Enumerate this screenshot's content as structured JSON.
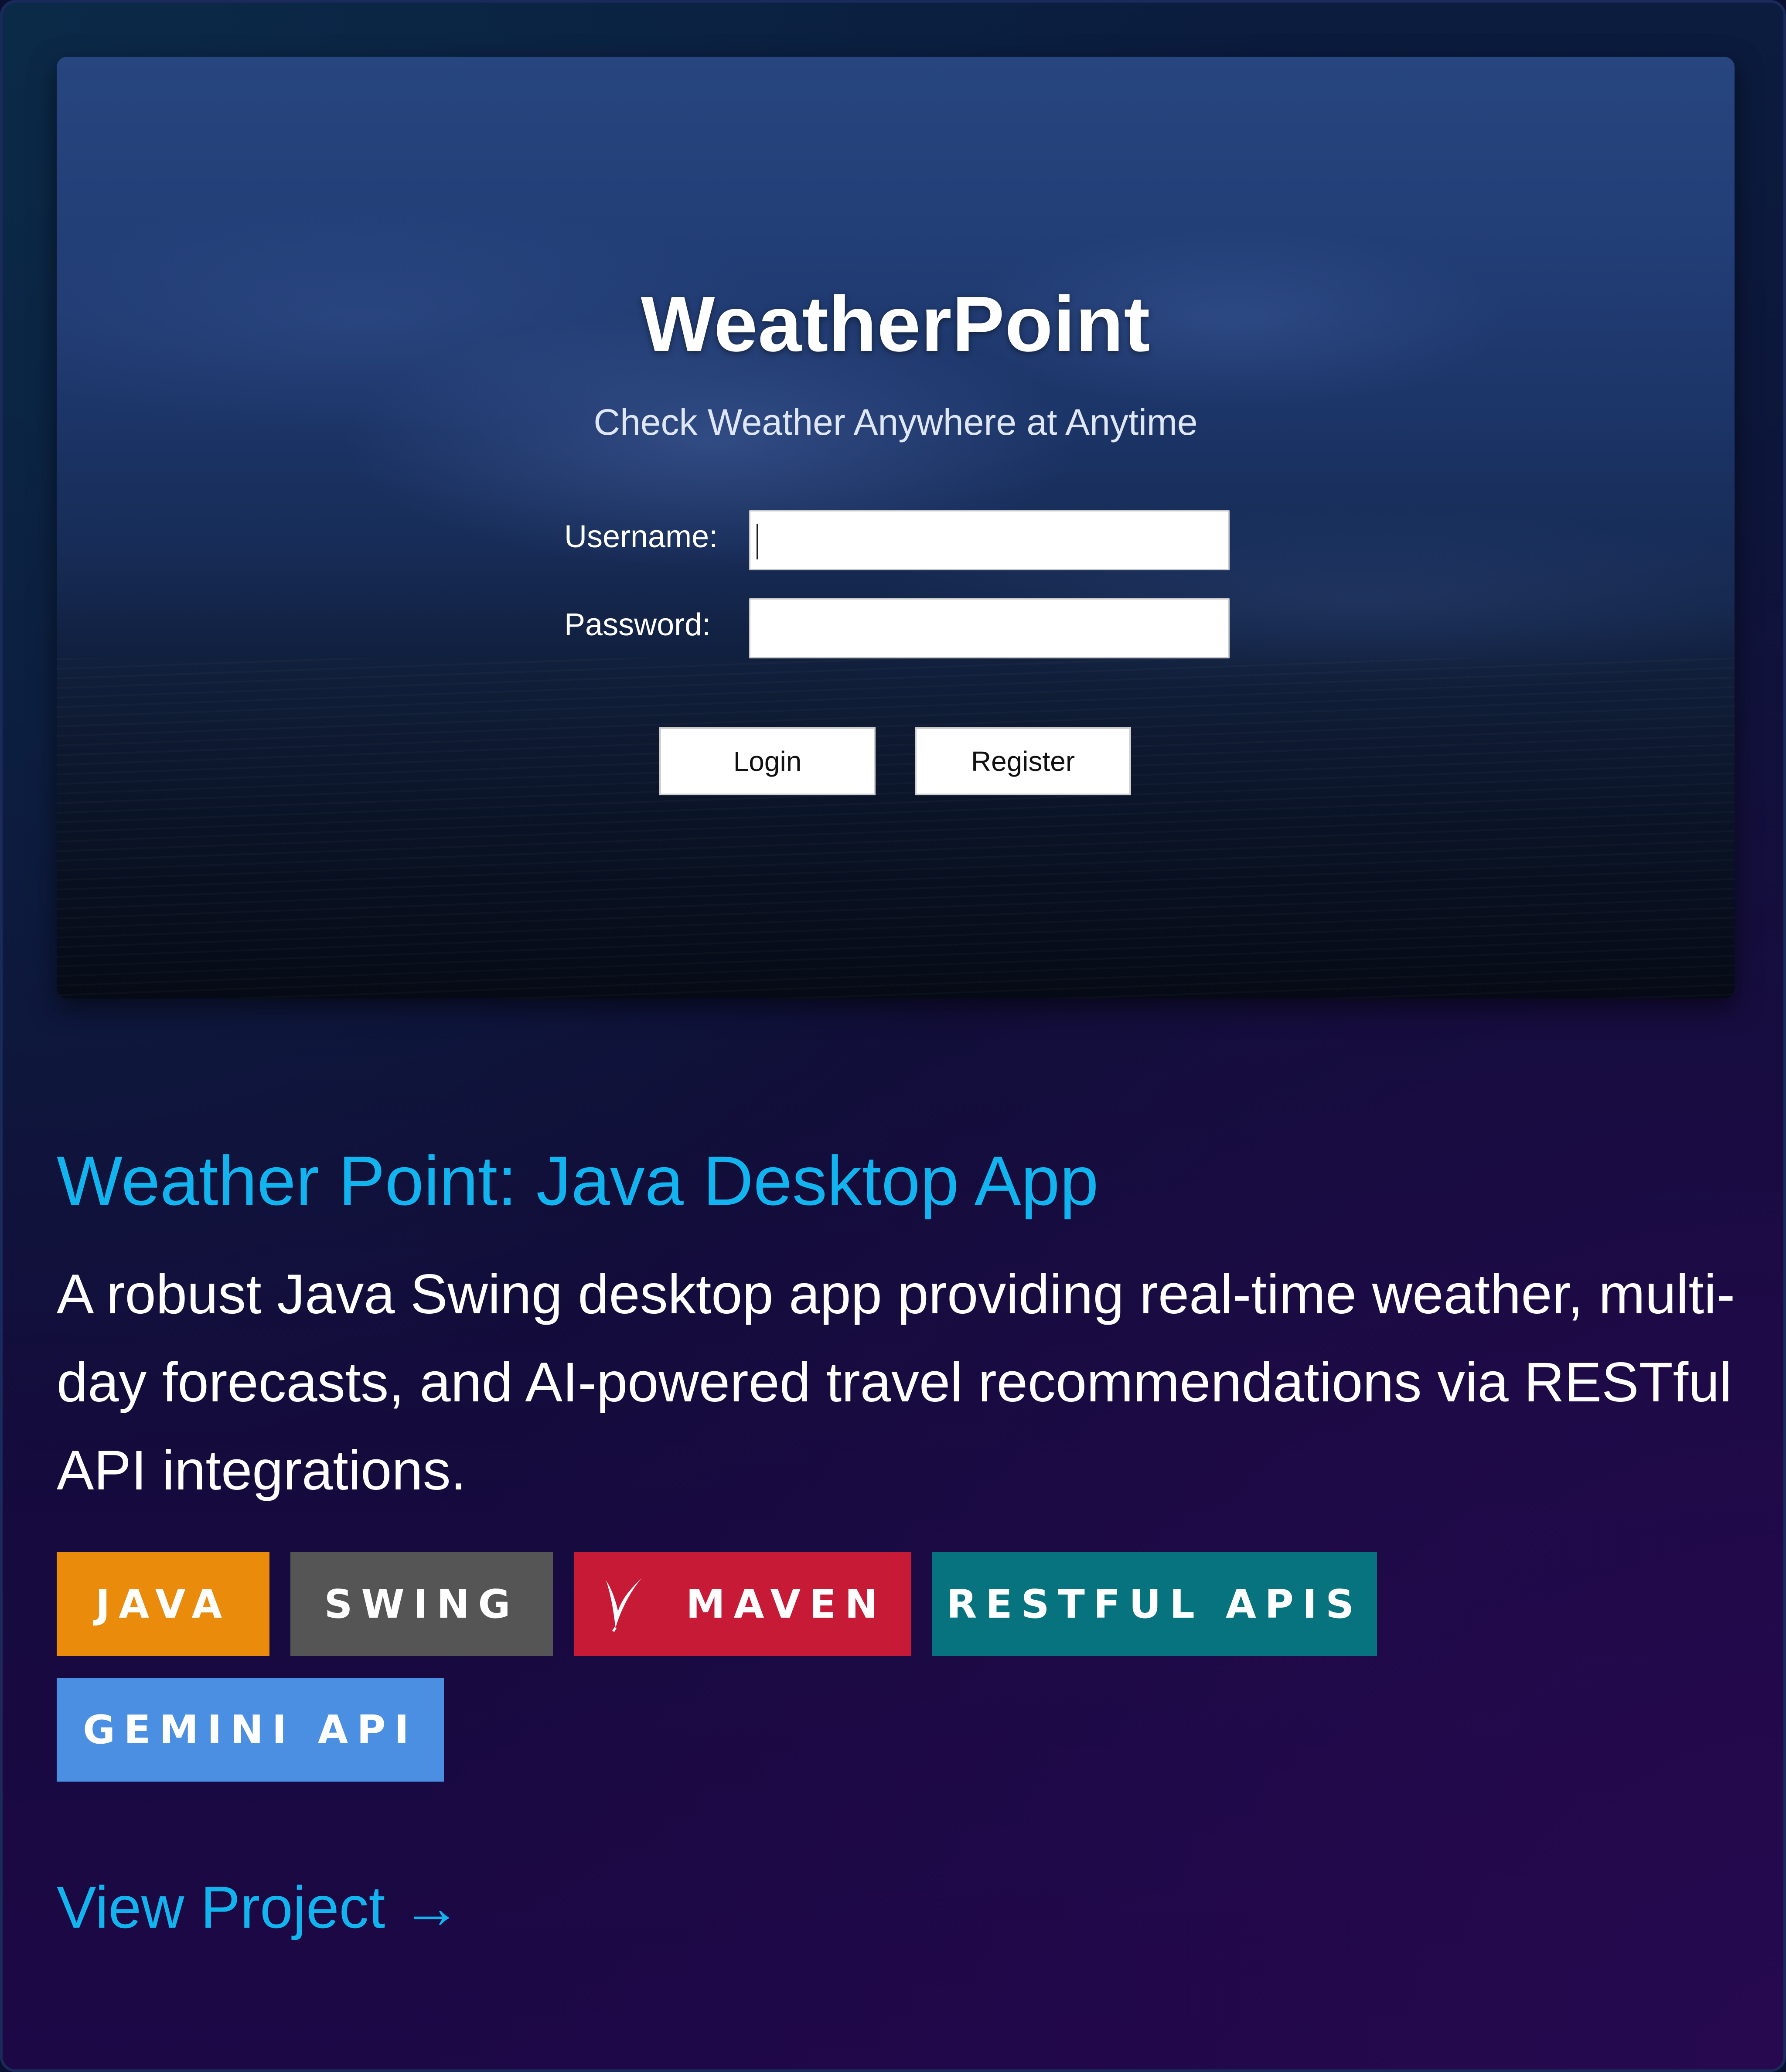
{
  "screenshot": {
    "app_title": "WeatherPoint",
    "app_subtitle": "Check Weather Anywhere at Anytime",
    "username_label": "Username:",
    "username_value": "",
    "password_label": "Password:",
    "password_value": "",
    "login_label": "Login",
    "register_label": "Register"
  },
  "project": {
    "title": "Weather Point: Java Desktop App",
    "description": "A robust Java Swing desktop app providing real-time weather, multi-day forecasts, and AI-powered travel recommendations via RESTful API integrations.",
    "link_label": "View Project →"
  },
  "tags": [
    {
      "label": "JAVA",
      "color": "#ea8b0c"
    },
    {
      "label": "SWING",
      "color": "#555555"
    },
    {
      "label": "MAVEN",
      "color": "#c71a36",
      "icon": "apache-feather-icon"
    },
    {
      "label": "RESTFUL APIS",
      "color": "#06737e"
    },
    {
      "label": "GEMINI API",
      "color": "#4a8fe2"
    }
  ],
  "colors": {
    "accent": "#12b4ef",
    "card_border": "#1a2a5a"
  }
}
